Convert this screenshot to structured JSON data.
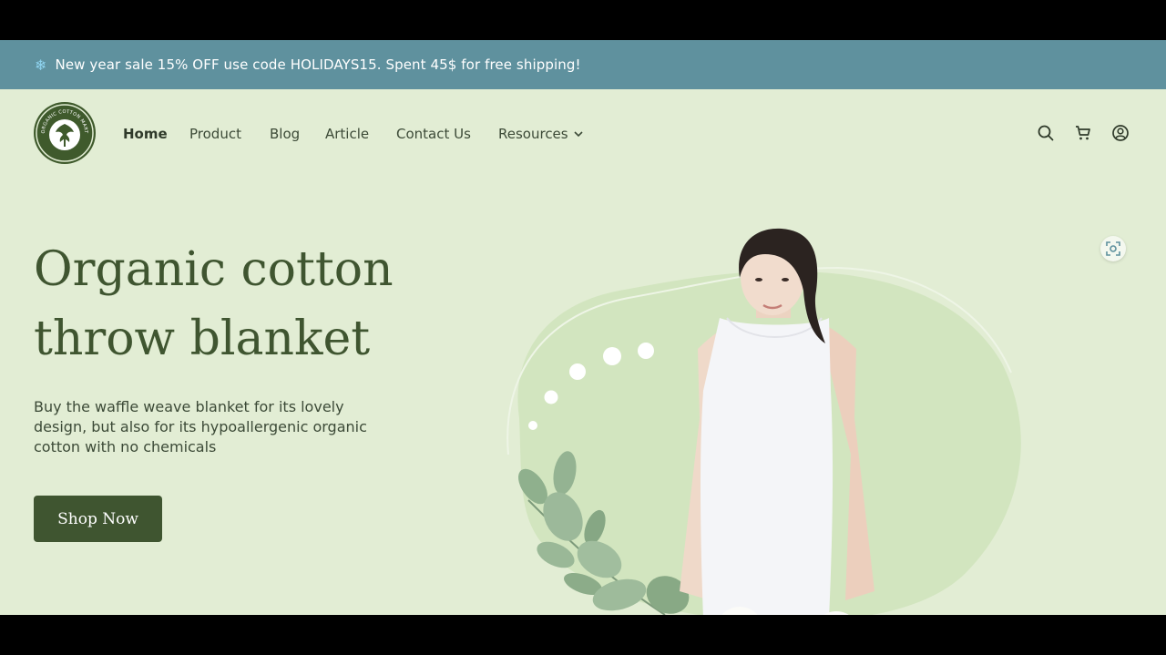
{
  "announcement": {
    "icon": "snowflake-icon",
    "text": "New year sale 15% OFF use code HOLIDAYS15. Spent 45$ for free shipping!"
  },
  "logo": {
    "text": "ORGANIC COTTON MART",
    "icon": "cotton-flower-logo"
  },
  "nav": {
    "items": [
      {
        "label": "Home",
        "active": true
      },
      {
        "label": "Product"
      },
      {
        "label": "Blog"
      },
      {
        "label": "Article"
      },
      {
        "label": "Contact Us"
      },
      {
        "label": "Resources",
        "has_dropdown": true
      }
    ],
    "chevron": "⌄"
  },
  "header_icons": [
    "search-icon",
    "cart-icon",
    "account-icon"
  ],
  "hero": {
    "title_line1": "Organic cotton",
    "title_line2": "throw blanket",
    "description": "Buy the waffle weave blanket for its lovely design, but also for its hypoallergenic organic cotton with no chemicals",
    "cta_label": "Shop Now"
  },
  "colors": {
    "announcement_bg": "#5f919e",
    "page_bg": "#e2edd4",
    "brand_green": "#3f5530",
    "blob": "#d2e5bf"
  }
}
